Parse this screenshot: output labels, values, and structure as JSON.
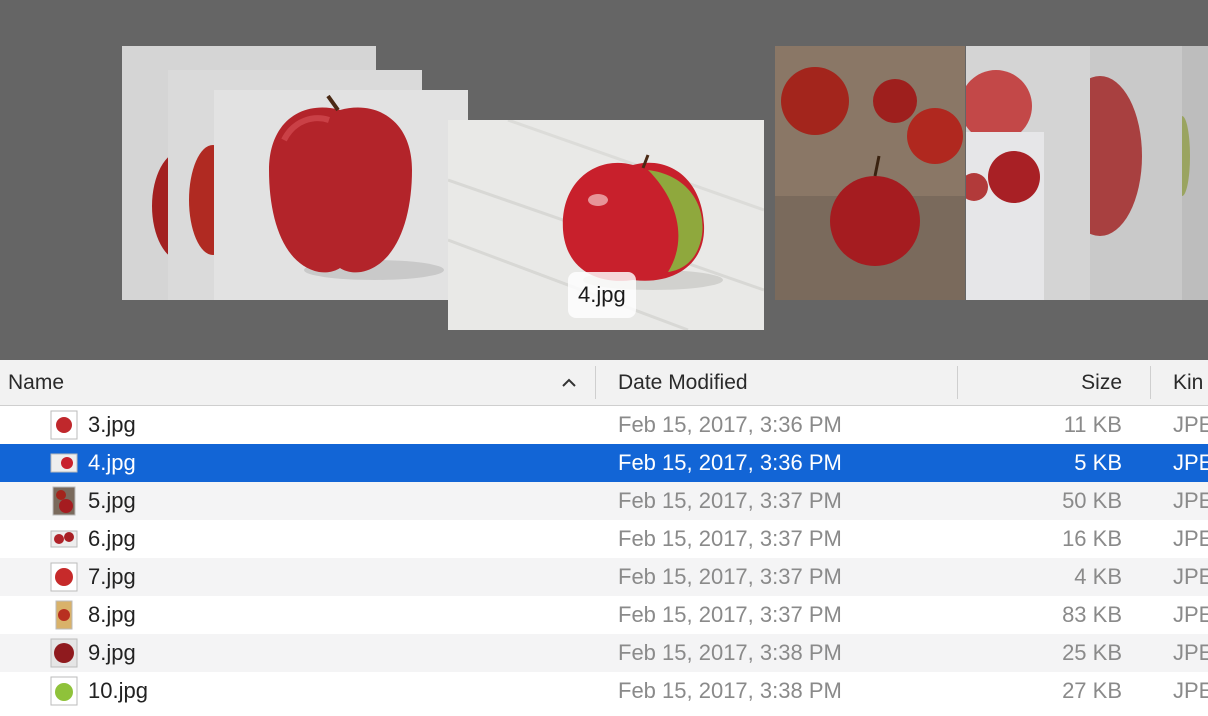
{
  "coverflow": {
    "current_label": "4.jpg"
  },
  "header": {
    "name": "Name",
    "date": "Date Modified",
    "size": "Size",
    "kind": "Kin"
  },
  "files": [
    {
      "name": "3.jpg",
      "date": "Feb 15, 2017, 3:36 PM",
      "size": "11 KB",
      "kind": "JPE",
      "icon": "apple-thumbnail-icon"
    },
    {
      "name": "4.jpg",
      "date": "Feb 15, 2017, 3:36 PM",
      "size": "5 KB",
      "kind": "JPE",
      "icon": "apple-thumbnail-icon"
    },
    {
      "name": "5.jpg",
      "date": "Feb 15, 2017, 3:37 PM",
      "size": "50 KB",
      "kind": "JPE",
      "icon": "apple-thumbnail-icon"
    },
    {
      "name": "6.jpg",
      "date": "Feb 15, 2017, 3:37 PM",
      "size": "16 KB",
      "kind": "JPE",
      "icon": "apple-thumbnail-icon"
    },
    {
      "name": "7.jpg",
      "date": "Feb 15, 2017, 3:37 PM",
      "size": "4 KB",
      "kind": "JPE",
      "icon": "apple-thumbnail-icon"
    },
    {
      "name": "8.jpg",
      "date": "Feb 15, 2017, 3:37 PM",
      "size": "83 KB",
      "kind": "JPE",
      "icon": "apple-thumbnail-icon"
    },
    {
      "name": "9.jpg",
      "date": "Feb 15, 2017, 3:38 PM",
      "size": "25 KB",
      "kind": "JPE",
      "icon": "apple-thumbnail-icon"
    },
    {
      "name": "10.jpg",
      "date": "Feb 15, 2017, 3:38 PM",
      "size": "27 KB",
      "kind": "JPE",
      "icon": "green-apple-thumbnail-icon"
    }
  ],
  "colors": {
    "selection": "#1265d6",
    "coverflow_bg": "#656565"
  }
}
